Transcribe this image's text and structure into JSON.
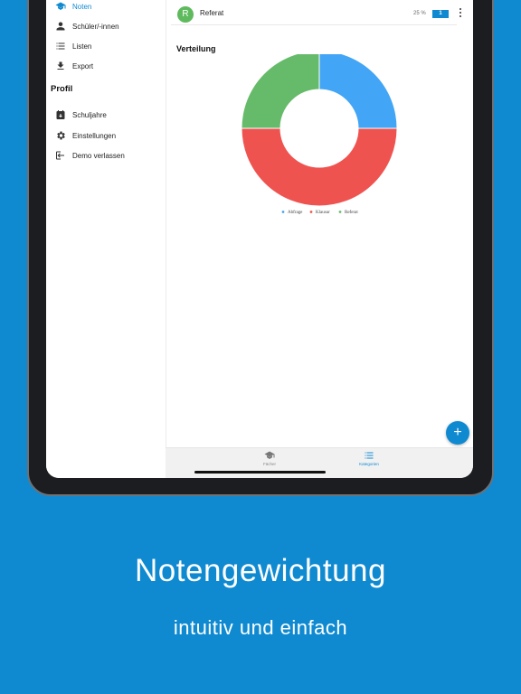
{
  "sidebar": {
    "items": [
      {
        "label": "Noten",
        "icon": "graduation-cap-icon",
        "active": true
      },
      {
        "label": "Schüler/-innen",
        "icon": "person-icon"
      },
      {
        "label": "Listen",
        "icon": "list-icon"
      },
      {
        "label": "Export",
        "icon": "download-icon"
      }
    ],
    "profile_title": "Profil",
    "profile_items": [
      {
        "label": "Schuljahre",
        "icon": "calendar-icon"
      },
      {
        "label": "Einstellungen",
        "icon": "gear-icon"
      },
      {
        "label": "Demo verlassen",
        "icon": "exit-icon"
      }
    ]
  },
  "category_row": {
    "avatar": "R",
    "label": "Referat",
    "percent": "25 %",
    "badge": "1"
  },
  "chart_title": "Verteilung",
  "chart_data": {
    "type": "pie",
    "title": "Verteilung",
    "series": [
      {
        "name": "Abfrage",
        "value": 25,
        "color": "#42a5f5"
      },
      {
        "name": "Klausur",
        "value": 50,
        "color": "#ef5350"
      },
      {
        "name": "Referat",
        "value": 25,
        "color": "#66bb6a"
      }
    ],
    "legend_position": "bottom"
  },
  "fab_label": "+",
  "bottom_nav": {
    "tabs": [
      {
        "label": "Fächer",
        "icon": "graduation-cap-icon",
        "active": false
      },
      {
        "label": "Kategorien",
        "icon": "list-icon",
        "active": true
      }
    ]
  },
  "colors": {
    "accent": "#0f8ad1",
    "background": "#0f8ad1"
  },
  "headline": "Notengewichtung",
  "subline": "intuitiv und einfach"
}
